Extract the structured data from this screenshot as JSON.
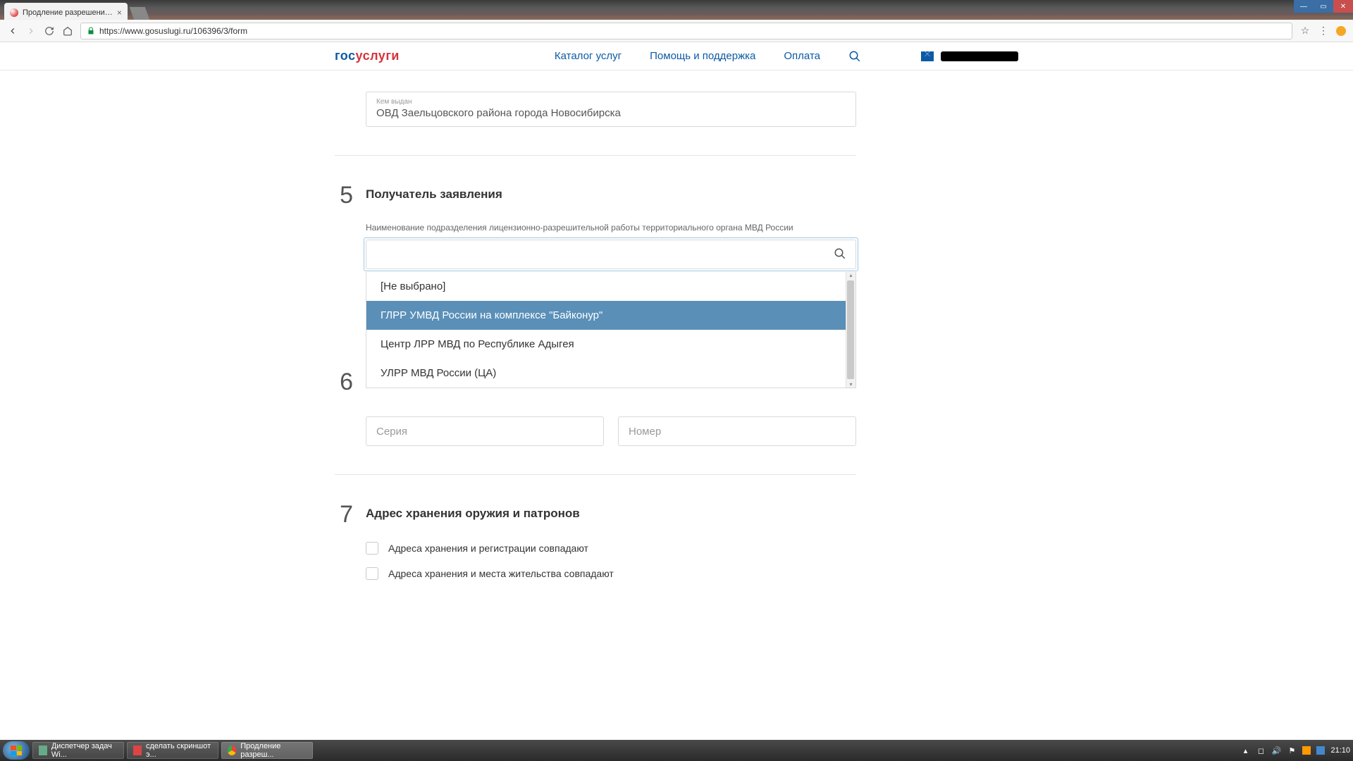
{
  "browser": {
    "tab_title": "Продление разрешени…",
    "url": "https://www.gosuslugi.ru/106396/3/form"
  },
  "header": {
    "logo_part1": "гос",
    "logo_part2": "услуги",
    "nav": {
      "catalog": "Каталог услуг",
      "help": "Помощь и поддержка",
      "payment": "Оплата"
    }
  },
  "section4": {
    "issued_by_label": "Кем выдан",
    "issued_by_value": "ОВД Заельцовского района города Новосибирска"
  },
  "section5": {
    "num": "5",
    "title": "Получатель заявления",
    "field_label": "Наименование подразделения лицензионно-разрешительной работы территориального органа МВД России",
    "search_value": "",
    "options": {
      "opt0": "[Не выбрано]",
      "opt1": "ГЛРР УМВД России на комплексе \"Байконур\"",
      "opt2": "Центр ЛРР МВД по Республике Адыгея",
      "opt3": "УЛРР МВД России (ЦА)"
    }
  },
  "section6": {
    "num": "6",
    "series_ph": "Серия",
    "number_ph": "Номер"
  },
  "section7": {
    "num": "7",
    "title": "Адрес хранения оружия и патронов",
    "check1": "Адреса хранения и регистрации совпадают",
    "check2": "Адреса хранения и места жительства совпадают"
  },
  "taskbar": {
    "item1": "Диспетчер задач Wi...",
    "item2": "сделать скриншот э...",
    "item3": "Продление разреш...",
    "clock": "21:10"
  }
}
